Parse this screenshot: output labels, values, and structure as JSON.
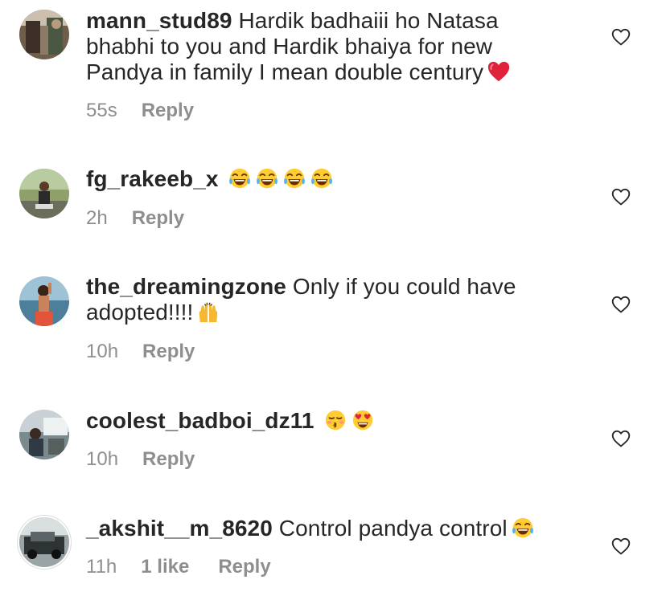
{
  "comments": [
    {
      "username": "mann_stud89",
      "text": " Hardik badhaiii ho Natasa bhabhi to you and Hardik bhaiya for new Pandya in family I mean double century",
      "emojis": [
        "red-heart"
      ],
      "time": "55s",
      "likes": "",
      "reply_label": "Reply"
    },
    {
      "username": "fg_rakeeb_x",
      "text": " ",
      "emojis": [
        "face-with-tears-of-joy",
        "face-with-tears-of-joy",
        "face-with-tears-of-joy",
        "face-with-tears-of-joy"
      ],
      "time": "2h",
      "likes": "",
      "reply_label": "Reply"
    },
    {
      "username": "the_dreamingzone",
      "text": " Only if you could have adopted!!!!",
      "emojis": [
        "raising-hands"
      ],
      "time": "10h",
      "likes": "",
      "reply_label": "Reply"
    },
    {
      "username": "coolest_badboi_dz11",
      "text": " ",
      "emojis": [
        "kissing-face-with-closed-eyes",
        "smiling-face-with-heart-eyes"
      ],
      "time": "10h",
      "likes": "",
      "reply_label": "Reply"
    },
    {
      "username": "_akshit__m_8620",
      "text": " Control pandya control",
      "emojis": [
        "face-with-tears-of-joy"
      ],
      "time": "11h",
      "likes": "1 like",
      "reply_label": "Reply"
    }
  ],
  "colors": {
    "text": "#262626",
    "meta": "#8e8e8e",
    "heart_outline": "#262626"
  }
}
